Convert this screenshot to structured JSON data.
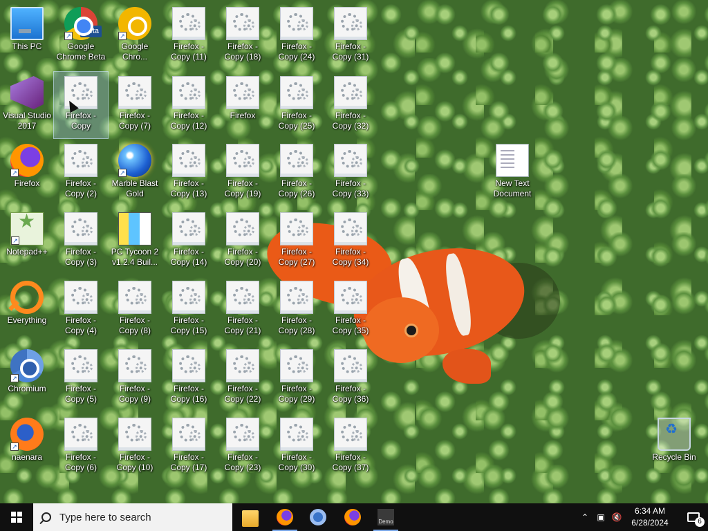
{
  "desktop": {
    "icons": {
      "this_pc": "This PC",
      "chrome_beta": "Google Chrome Beta",
      "chrome_beta_badge": "Beta",
      "google_chrome": "Google Chro...",
      "visual_studio": "Visual Studio 2017",
      "firefox_copy": "Firefox - Copy",
      "firefox_copy_7": "Firefox - Copy (7)",
      "firefox_copy_11": "Firefox - Copy (11)",
      "firefox_copy_12": "Firefox - Copy (12)",
      "firefox_copy_18": "Firefox - Copy (18)",
      "firefox_generic": "Firefox",
      "firefox_copy_24": "Firefox - Copy (24)",
      "firefox_copy_25": "Firefox - Copy (25)",
      "firefox_copy_31": "Firefox - Copy (31)",
      "firefox_copy_32": "Firefox - Copy (32)",
      "firefox": "Firefox",
      "firefox_copy_2": "Firefox - Copy (2)",
      "marble_blast": "Marble Blast Gold",
      "firefox_copy_13": "Firefox - Copy (13)",
      "firefox_copy_19": "Firefox - Copy (19)",
      "firefox_copy_26": "Firefox - Copy (26)",
      "firefox_copy_33": "Firefox - Copy (33)",
      "new_text_document": "New Text Document",
      "notepadpp": "Notepad++",
      "firefox_copy_3": "Firefox - Copy (3)",
      "pc_tycoon": "PC Tycoon 2 v1.2.4 Buil...",
      "firefox_copy_14": "Firefox - Copy (14)",
      "firefox_copy_20": "Firefox - Copy (20)",
      "firefox_copy_27": "Firefox - Copy (27)",
      "firefox_copy_34": "Firefox - Copy (34)",
      "everything": "Everything",
      "firefox_copy_4": "Firefox - Copy (4)",
      "firefox_copy_8": "Firefox - Copy (8)",
      "firefox_copy_15": "Firefox - Copy (15)",
      "firefox_copy_21": "Firefox - Copy (21)",
      "firefox_copy_28": "Firefox - Copy (28)",
      "firefox_copy_35": "Firefox - Copy (35)",
      "chromium": "Chromium",
      "firefox_copy_5": "Firefox - Copy (5)",
      "firefox_copy_9": "Firefox - Copy (9)",
      "firefox_copy_16": "Firefox - Copy (16)",
      "firefox_copy_22": "Firefox - Copy (22)",
      "firefox_copy_29": "Firefox - Copy (29)",
      "firefox_copy_36": "Firefox - Copy (36)",
      "naenara": "naenara",
      "firefox_copy_6": "Firefox - Copy (6)",
      "firefox_copy_10": "Firefox - Copy (10)",
      "firefox_copy_17": "Firefox - Copy (17)",
      "firefox_copy_23": "Firefox - Copy (23)",
      "firefox_copy_30": "Firefox - Copy (30)",
      "firefox_copy_37": "Firefox - Copy (37)",
      "recycle_bin": "Recycle Bin"
    }
  },
  "taskbar": {
    "search_placeholder": "Type here to search",
    "pinned": [
      "file-explorer-icon",
      "firefox-icon",
      "chromium-icon",
      "firefox-icon",
      "demo-app-icon"
    ],
    "demo_label": "Demo",
    "clock_time": "6:34 AM",
    "clock_date": "6/28/2024",
    "notification_count": "6"
  },
  "colors": {
    "taskbar_bg": "#101010",
    "search_bg": "#f2f2f2",
    "selection": "#aac8eb"
  }
}
